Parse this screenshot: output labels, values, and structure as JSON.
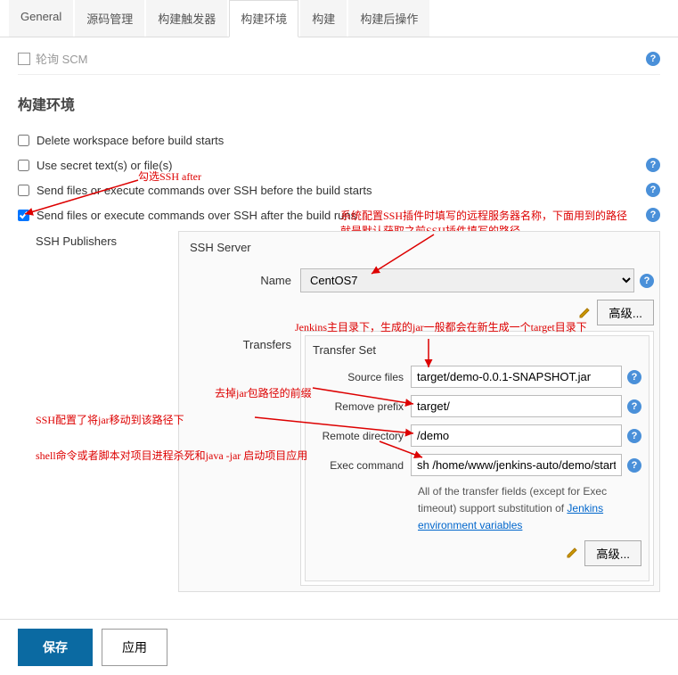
{
  "tabs": {
    "general": "General",
    "scm": "源码管理",
    "triggers": "构建触发器",
    "env": "构建环境",
    "build": "构建",
    "post": "构建后操作"
  },
  "truncated": "轮询 SCM",
  "section": {
    "title": "构建环境"
  },
  "options": {
    "delete_ws": "Delete workspace before build starts",
    "secret": "Use secret text(s) or file(s)",
    "ssh_before": "Send files or execute commands over SSH before the build starts",
    "ssh_after": "Send files or execute commands over SSH after the build runs"
  },
  "ssh": {
    "publishers_label": "SSH Publishers",
    "server_title": "SSH Server",
    "name_label": "Name",
    "name_value": "CentOS7",
    "advanced": "高级...",
    "transfers_label": "Transfers",
    "transfer_set": "Transfer Set",
    "source_files_label": "Source files",
    "source_files_value": "target/demo-0.0.1-SNAPSHOT.jar",
    "remove_prefix_label": "Remove prefix",
    "remove_prefix_value": "target/",
    "remote_dir_label": "Remote directory",
    "remote_dir_value": "/demo",
    "exec_label": "Exec command",
    "exec_value": "sh /home/www/jenkins-auto/demo/start.sh",
    "footnote_text": "All of the transfer fields (except for Exec timeout) support substitution of ",
    "footnote_link": "Jenkins environment variables"
  },
  "buttons": {
    "save": "保存",
    "apply": "应用"
  },
  "annotations": {
    "a1": "勾选SSH after",
    "a2_line1": "系统配置SSH插件时填写的远程服务器名称，下面用到的路径",
    "a2_line2": "就是默认获取之前SSH插件填写的路径",
    "a3": "Jenkins主目录下，生成的jar一般都会在新生成一个target目录下",
    "a4": "去掉jar包路径的前缀",
    "a5": "SSH配置了将jar移动到该路径下",
    "a6": "shell命令或者脚本对项目进程杀死和java -jar 启动项目应用"
  }
}
